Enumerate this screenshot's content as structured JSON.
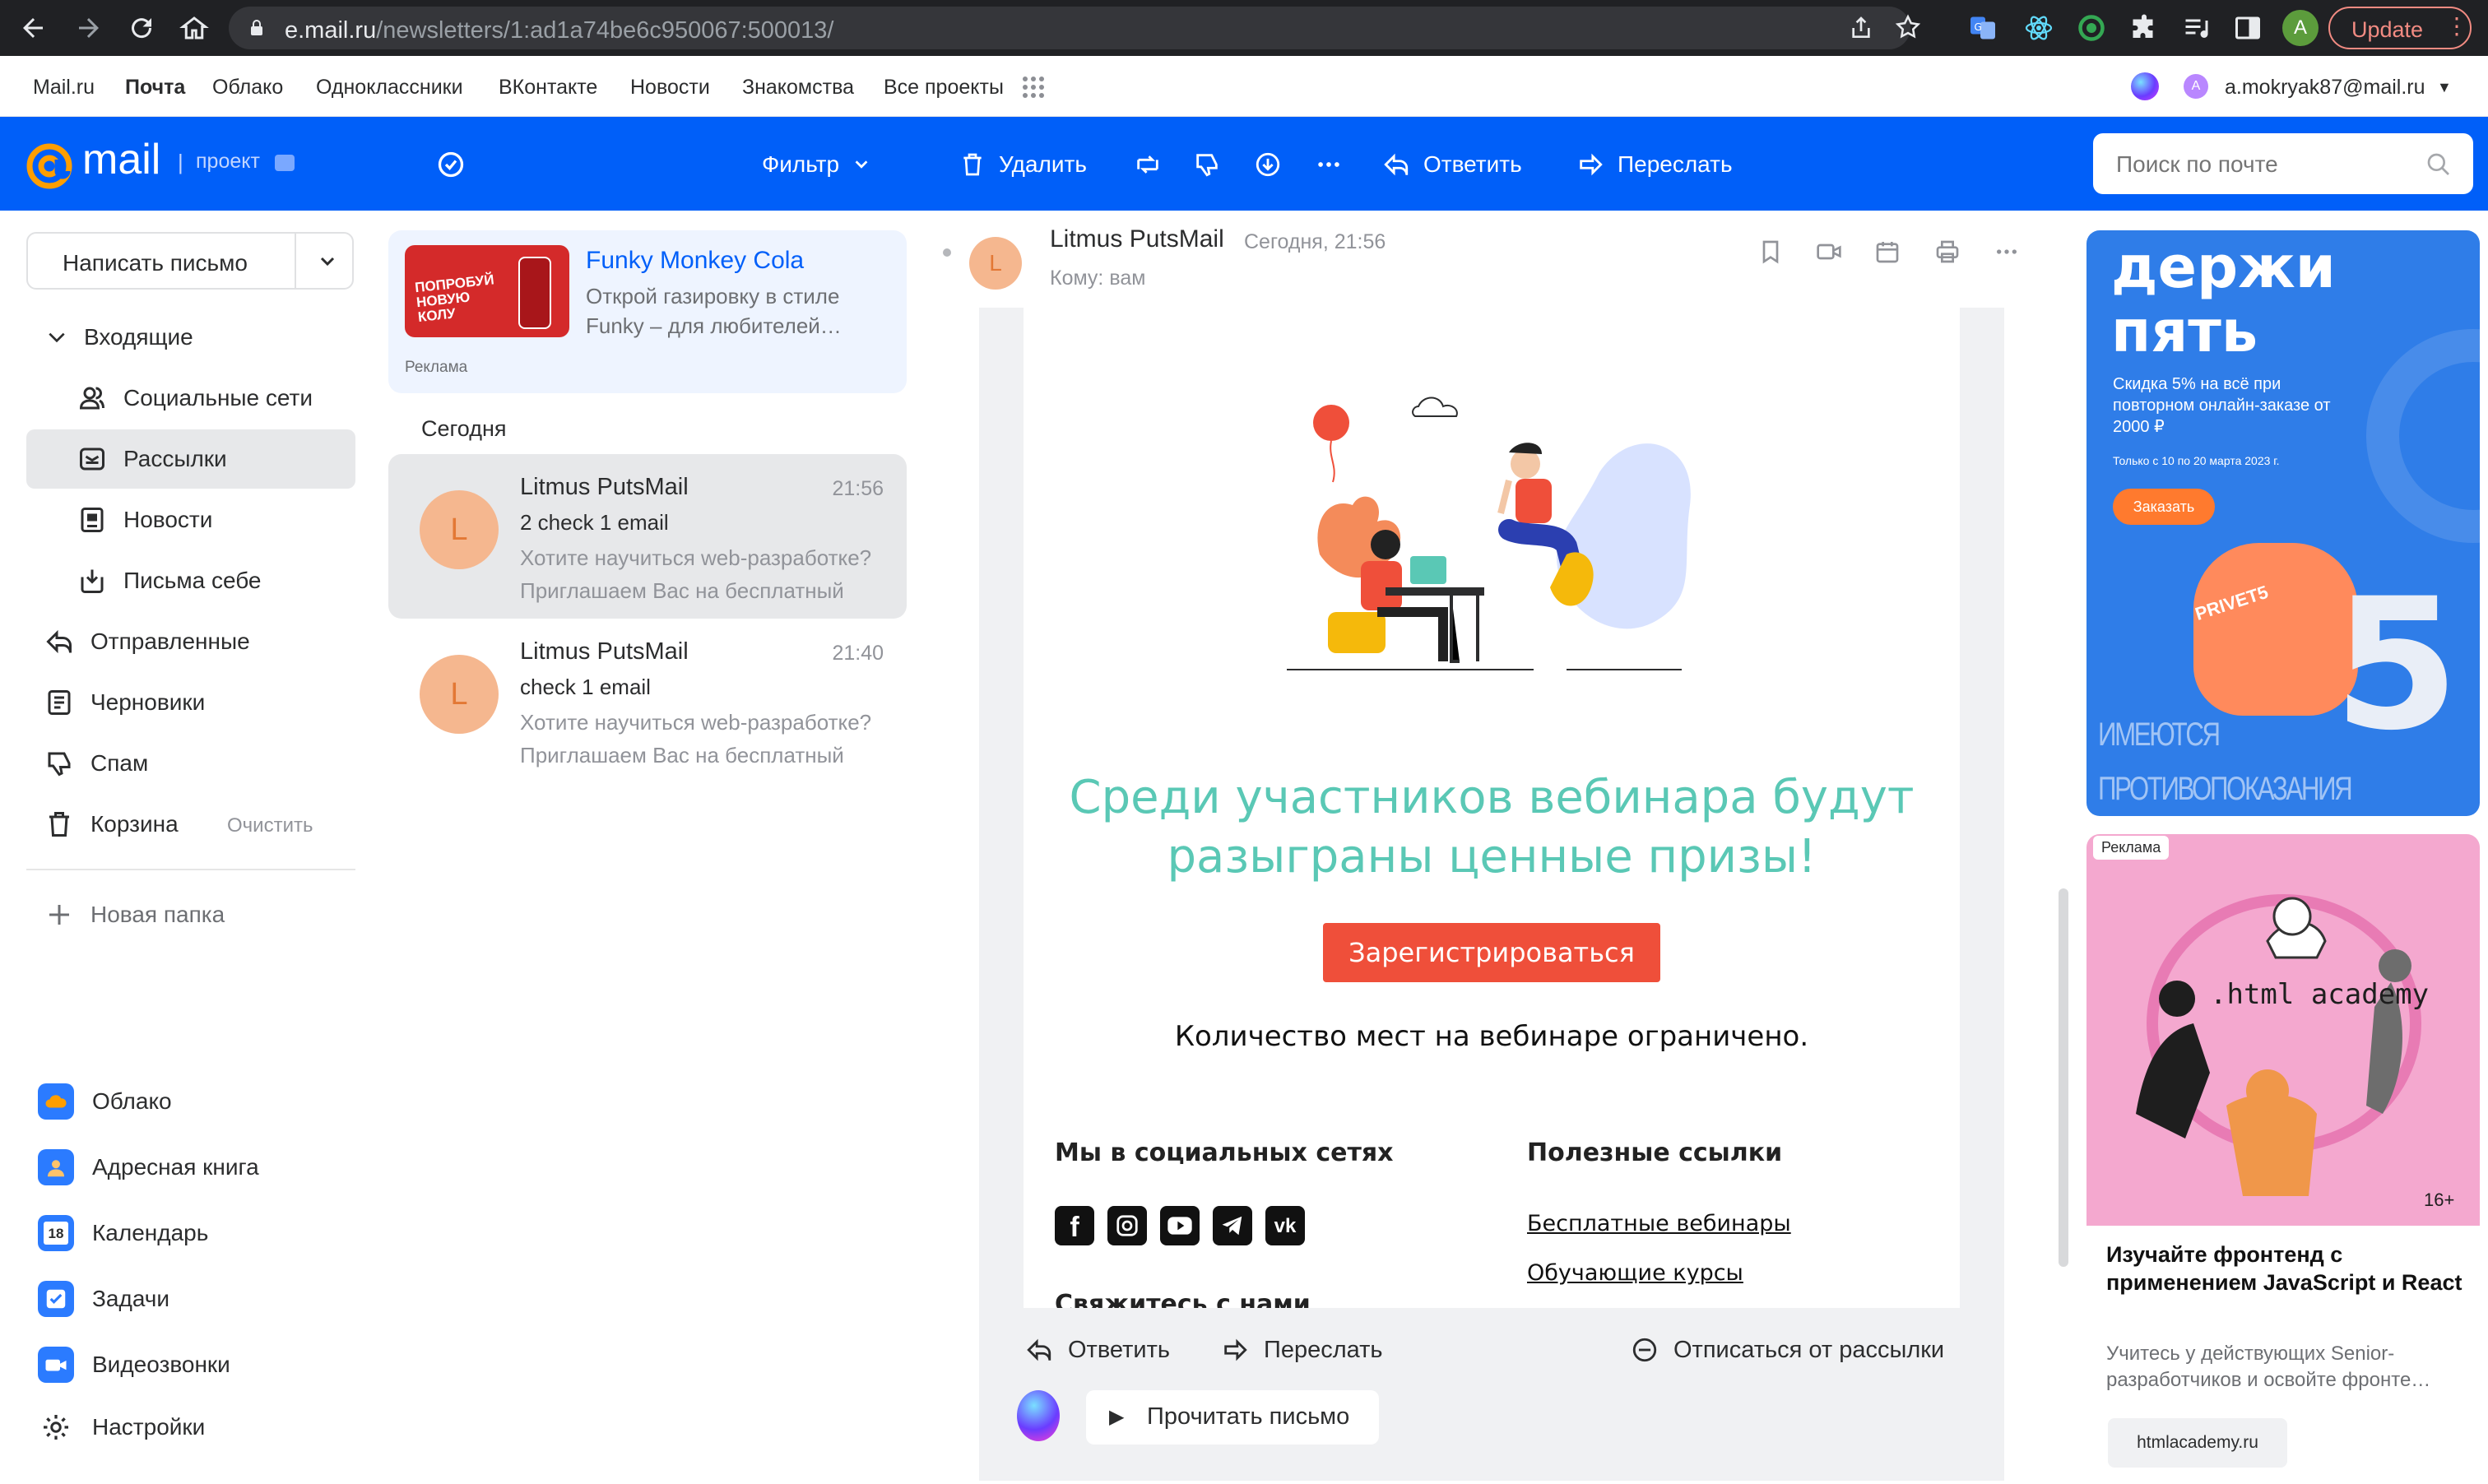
{
  "browser": {
    "url_host": "e.mail.ru",
    "url_path": "/newsletters/1:ad1a74be6c950067:500013/",
    "update_label": "Update",
    "profile_initial": "A"
  },
  "portal": {
    "links": [
      "Mail.ru",
      "Почта",
      "Облако",
      "Одноклассники",
      "ВКонтакте",
      "Новости",
      "Знакомства",
      "Все проекты"
    ],
    "account": "a.mokryak87@mail.ru",
    "account_initial": "A"
  },
  "toolbar": {
    "logo": "mail",
    "project_label": "проект",
    "filter": "Фильтр",
    "delete": "Удалить",
    "reply": "Ответить",
    "forward": "Переслать",
    "search_placeholder": "Поиск по почте"
  },
  "sidebar": {
    "compose": "Написать письмо",
    "folders": [
      {
        "label": "Входящие"
      },
      {
        "label": "Социальные сети"
      },
      {
        "label": "Рассылки"
      },
      {
        "label": "Новости"
      },
      {
        "label": "Письма себе"
      },
      {
        "label": "Отправленные"
      },
      {
        "label": "Черновики"
      },
      {
        "label": "Спам"
      },
      {
        "label": "Корзина"
      }
    ],
    "clear": "Очистить",
    "new_folder": "Новая папка",
    "apps": [
      "Облако",
      "Адресная книга",
      "Календарь",
      "Задачи",
      "Видеозвонки",
      "Настройки"
    ],
    "calendar_day": "18"
  },
  "list": {
    "ad": {
      "title": "Funky Monkey Cola",
      "text": "Открой газировку в стиле Funky – для любителей…",
      "tag": "Реклама",
      "img_text": "ПОПРОБУЙ НОВУЮ КОЛУ"
    },
    "group_label": "Сегодня",
    "messages": [
      {
        "initial": "L",
        "from": "Litmus PutsMail",
        "time": "21:56",
        "subject": "2 check 1 email",
        "snippet": "Хотите научиться web-разработке? Приглашаем Вас на бесплатный"
      },
      {
        "initial": "L",
        "from": "Litmus PutsMail",
        "time": "21:40",
        "subject": "check 1 email",
        "snippet": "Хотите научиться web-разработке? Приглашаем Вас на бесплатный"
      }
    ]
  },
  "reader": {
    "avatar_initial": "L",
    "from": "Litmus PutsMail",
    "date": "Сегодня, 21:56",
    "to": "Кому: вам",
    "headline": "Среди участников вебинара будут разыграны ценные призы!",
    "cta": "Зарегистрироваться",
    "limited": "Количество мест на вебинаре ограничено.",
    "social_title": "Мы в социальных сетях",
    "links_title": "Полезные ссылки",
    "links": [
      "Бесплатные вебинары",
      "Обучающие курсы"
    ],
    "contact_partial": "Свяжитесь с нами",
    "bottom": {
      "reply": "Ответить",
      "forward": "Переслать",
      "unsubscribe": "Отписаться от рассылки",
      "read_aloud": "Прочитать письмо"
    }
  },
  "ads": {
    "top": {
      "title": "держи пять",
      "text": "Скидка 5% на всё при повторном онлайн-заказе от 2000 ₽",
      "small": "Только с 10 по 20 марта 2023 г.",
      "button": "Заказать",
      "code": "PRIVET5",
      "warning": "ИМЕЮТСЯ ПРОТИВОПОКАЗАНИЯ ОЗНАКОМЬТЕСЬ С ИНСТРУКЦИЕЙ"
    },
    "bottom": {
      "tag": "Реклама",
      "brand": ".html academy",
      "age": "16+",
      "title": "Изучайте фронтенд с применением JavaScript и React",
      "text": "Учитесь у действующих Senior-разработчиков и освойте фронте…",
      "domain": "htmlacademy.ru"
    }
  },
  "colors": {
    "brand_blue": "#005ff9",
    "teal_headline": "#5ac8b5",
    "cta_red": "#ef4f3a",
    "avatar_bg": "#f5b78f"
  }
}
